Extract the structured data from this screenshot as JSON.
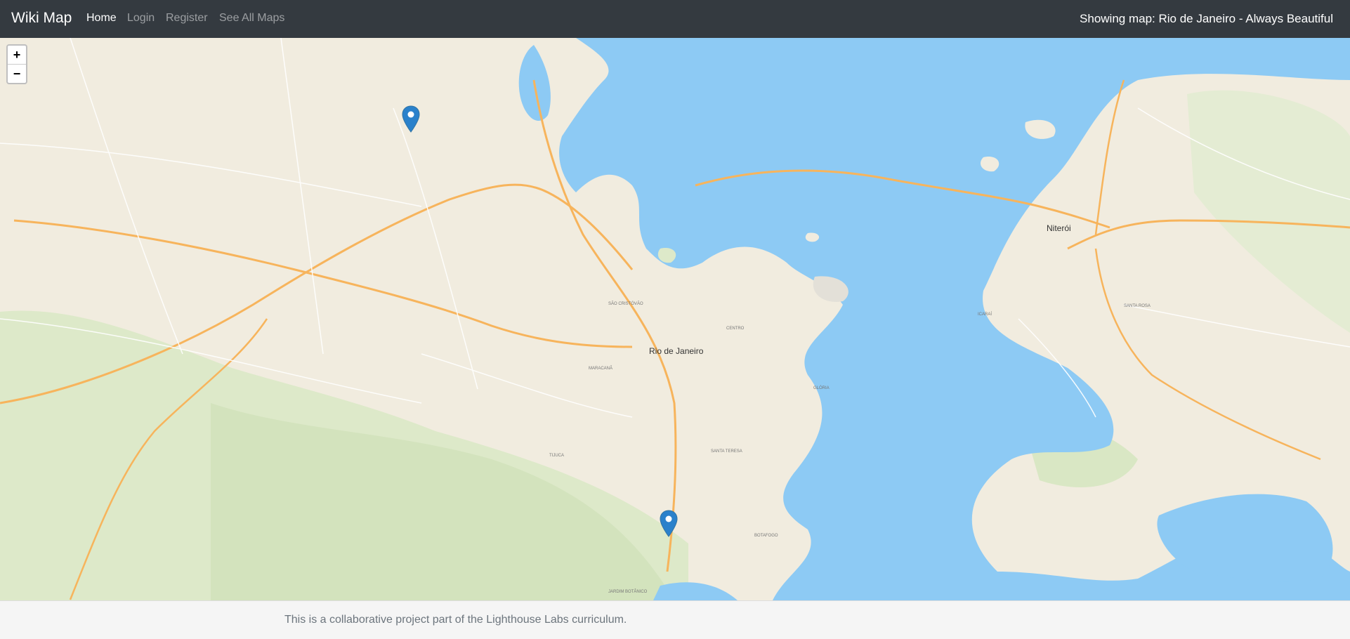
{
  "navbar": {
    "brand": "Wiki Map",
    "links": [
      "Home",
      "Login",
      "Register",
      "See All Maps"
    ],
    "active": "Home",
    "map_title": "Showing map: Rio de Janeiro - Always Beautiful"
  },
  "map": {
    "zoom_in": "+",
    "zoom_out": "−",
    "labels": {
      "rio": "Rio de Janeiro",
      "niteroi": "Niterói"
    },
    "district_labels": [
      "CENTRO",
      "SANTA TERESA",
      "BOTAFOGO",
      "GLÓRIA",
      "MARACANÃ",
      "TIJUCA",
      "SÃO CRISTÓVÃO",
      "ICARAÍ",
      "SANTA ROSA",
      "JARDIM BOTÂNICO"
    ],
    "markers": [
      {
        "name": "marker-1"
      },
      {
        "name": "marker-2"
      }
    ],
    "colors": {
      "water": "#8dcaf4",
      "land": "#f1ecdf",
      "park": "#d9e7c4",
      "road": "#f7b45c",
      "marker": "#2a81cb"
    }
  },
  "footer": {
    "text": "This is a collaborative project part of the Lighthouse Labs curriculum."
  }
}
